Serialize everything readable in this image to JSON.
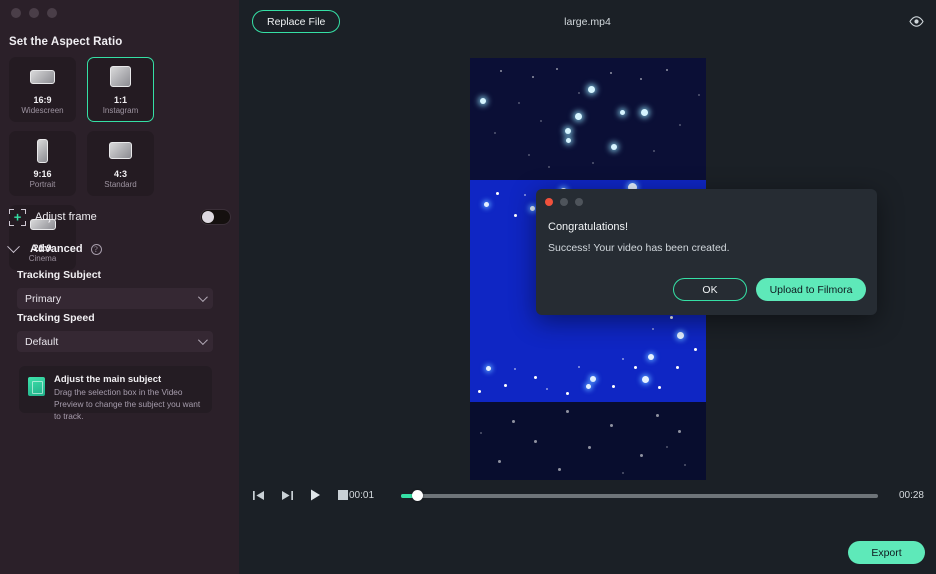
{
  "sidebar": {
    "window_controls": [
      "minimize",
      "maximize",
      "close"
    ],
    "panel_title": "Set the Aspect Ratio",
    "ratios": [
      {
        "name": "16:9",
        "sub": "Widescreen",
        "shape": "sh-16-9",
        "selected": false
      },
      {
        "name": "1:1",
        "sub": "Instagram",
        "shape": "sh-1-1",
        "selected": true
      },
      {
        "name": "9:16",
        "sub": "Portrait",
        "shape": "sh-9-16",
        "selected": false
      },
      {
        "name": "4:3",
        "sub": "Standard",
        "shape": "sh-4-3",
        "selected": false
      },
      {
        "name": "21:9",
        "sub": "Cinema",
        "shape": "sh-21-9",
        "selected": false
      }
    ],
    "adjust_frame": {
      "label": "Adjust frame",
      "icon": "crop-frame-icon",
      "toggle_state": "off"
    },
    "advanced": {
      "label": "Advanced",
      "expanded": true,
      "help_glyph": "?"
    },
    "tracking_subject": {
      "label": "Tracking Subject",
      "value": "Primary"
    },
    "tracking_speed": {
      "label": "Tracking Speed",
      "value": "Default"
    },
    "tip": {
      "title": "Adjust the main subject",
      "description": "Drag the selection box in the Video Preview to change the subject you want to track."
    }
  },
  "topbar": {
    "replace_file_label": "Replace File",
    "file_name": "large.mp4",
    "preview_toggle_icon": "eye-icon"
  },
  "playback": {
    "prev_frame_icon": "step-backward-icon",
    "next_frame_icon": "step-forward-icon",
    "play_icon": "play-icon",
    "stop_icon": "stop-icon",
    "current_time": "00:01",
    "total_time": "00:28",
    "progress_percent": 3,
    "export_label": "Export"
  },
  "dialog": {
    "title": "Congratulations!",
    "message": "Success! Your video has been created.",
    "ok_label": "OK",
    "upload_label": "Upload to Filmora"
  },
  "colors": {
    "accent": "#35e0a5",
    "accent_fill": "#5ee9b9",
    "sidebar_bg": "#2b2029",
    "main_bg": "#1b2026",
    "dialog_bg": "#262c33",
    "close_red": "#f0513c",
    "video_band_top": "#0b0f36",
    "video_band_mid": "#0f26c4",
    "video_band_bottom": "#080d2e"
  }
}
